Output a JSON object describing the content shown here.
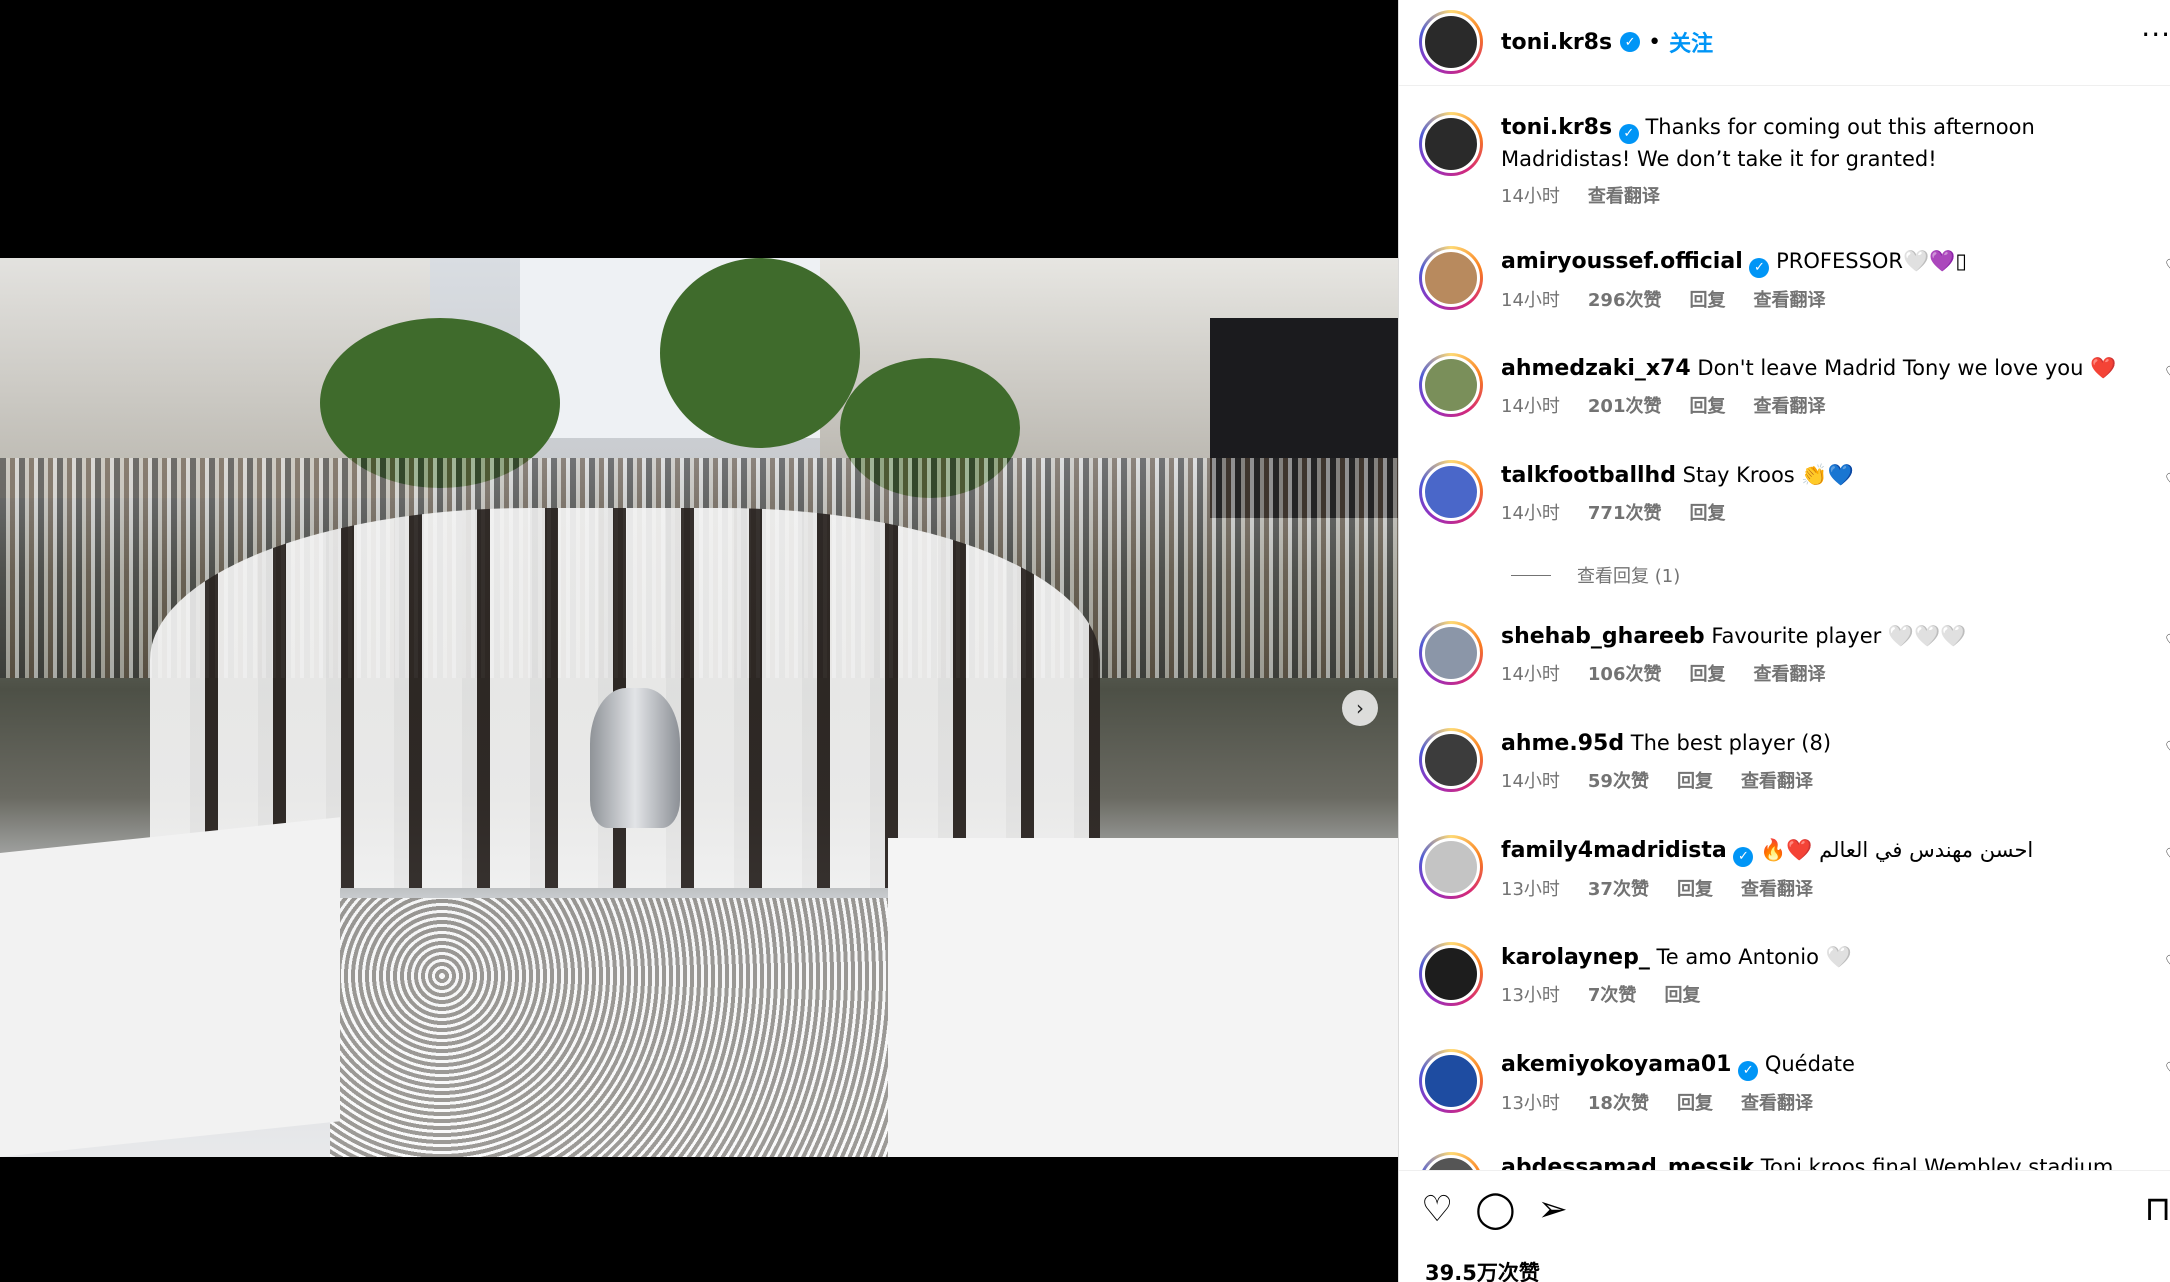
{
  "post": {
    "author": "toni.kr8s",
    "follow_label": "关注",
    "dot": "•",
    "more_icon": "more-horizontal-icon",
    "caption": "Thanks for coming out this afternoon Madridistas! We don’t take it for granted!",
    "caption_time": "14小时",
    "caption_translate": "查看翻译",
    "likes": "39.5万次赞"
  },
  "comments": [
    {
      "user": "amiryoussef.official",
      "verified": true,
      "text": "PROFESSOR🤍💜▯",
      "time": "14小时",
      "likes": "296次赞",
      "reply": "回复",
      "translate": "查看翻译"
    },
    {
      "user": "ahmedzaki_x74",
      "verified": false,
      "text": "Don't leave Madrid Tony we love you ❤️",
      "time": "14小时",
      "likes": "201次赞",
      "reply": "回复",
      "translate": "查看翻译"
    },
    {
      "user": "talkfootballhd",
      "verified": false,
      "text": "Stay Kroos 👏💙",
      "time": "14小时",
      "likes": "771次赞",
      "reply": "回复",
      "translate": ""
    },
    {
      "user": "shehab_ghareeb",
      "verified": false,
      "text": "Favourite player 🤍🤍🤍",
      "time": "14小时",
      "likes": "106次赞",
      "reply": "回复",
      "translate": "查看翻译"
    },
    {
      "user": "ahme.95d",
      "verified": false,
      "text": "The best player (8)",
      "time": "14小时",
      "likes": "59次赞",
      "reply": "回复",
      "translate": "查看翻译"
    },
    {
      "user": "family4madridista",
      "verified": true,
      "text": "🔥❤️ احسن مهندس في العالم",
      "time": "13小时",
      "likes": "37次赞",
      "reply": "回复",
      "translate": "查看翻译"
    },
    {
      "user": "karolaynep_",
      "verified": false,
      "text": "Te amo Antonio 🤍",
      "time": "13小时",
      "likes": "7次赞",
      "reply": "回复",
      "translate": ""
    },
    {
      "user": "akemiyokoyama01",
      "verified": true,
      "text": "Quédate",
      "time": "13小时",
      "likes": "18次赞",
      "reply": "回复",
      "translate": "查看翻译"
    },
    {
      "user": "abdessamad_messik",
      "verified": false,
      "text": "Toni kroos final Wembley stadium 😍🔥",
      "time": "",
      "likes": "",
      "reply": "",
      "translate": ""
    }
  ],
  "view_replies": "查看回复 (1)",
  "icons": {
    "like": "heart-icon",
    "comment": "comment-icon",
    "share": "share-icon",
    "save": "bookmark-icon",
    "next": "chevron-right-icon"
  }
}
